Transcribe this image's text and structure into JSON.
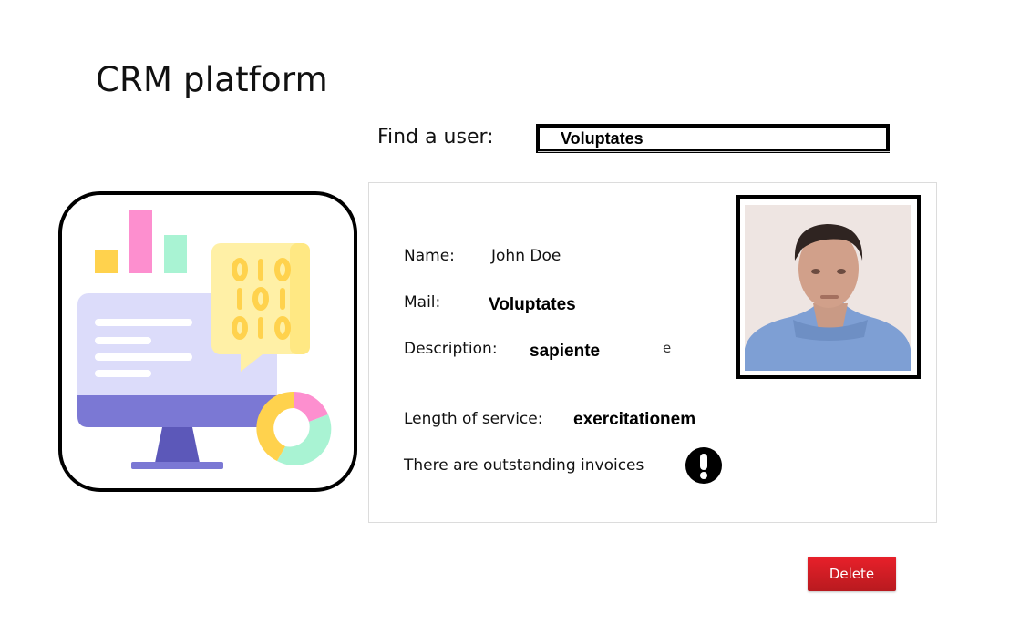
{
  "app": {
    "title": "CRM platform"
  },
  "search": {
    "label": "Find a user:",
    "value": "Voluptates"
  },
  "user": {
    "name_label": "Name:",
    "name": "John Doe",
    "mail_label": "Mail:",
    "mail": "Voluptates",
    "description_label": "Description:",
    "description": "sapiente",
    "description_trailing": "e",
    "service_label": "Length of service:",
    "service": "exercitationem",
    "invoice_notice": "There are outstanding invoices"
  },
  "icons": {
    "illustration": "crm-dashboard-illustration",
    "photo": "user-photo",
    "warning": "exclamation-icon"
  },
  "actions": {
    "delete_label": "Delete"
  },
  "colors": {
    "delete": "#d71f26",
    "chart_yellow": "#ffd24d",
    "chart_pink": "#fd8fcf",
    "chart_mint": "#a9f3d3",
    "screen_purple": "#7b78d4"
  }
}
